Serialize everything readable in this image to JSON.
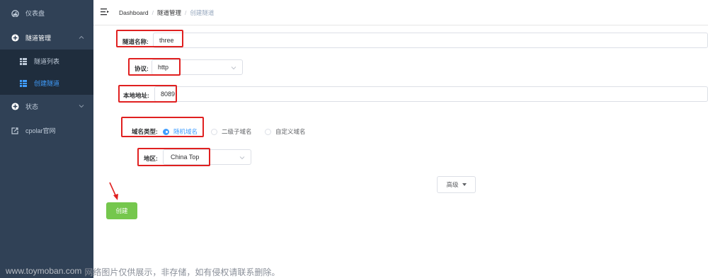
{
  "sidebar": {
    "items": [
      {
        "label": "仪表盘",
        "icon": "dashboard-icon"
      },
      {
        "label": "隧道管理",
        "icon": "plus-circle-icon",
        "expanded": true
      },
      {
        "label": "隧道列表",
        "icon": "grid-icon"
      },
      {
        "label": "创建隧道",
        "icon": "grid-icon",
        "active": true
      },
      {
        "label": "状态",
        "icon": "plus-circle-icon"
      },
      {
        "label": "cpolar官网",
        "icon": "external-link-icon"
      }
    ]
  },
  "breadcrumb": [
    "Dashboard",
    "隧道管理",
    "创建隧道"
  ],
  "breadcrumb_separator": "/",
  "form": {
    "tunnel_name": {
      "label": "隧道名称:",
      "value": "three"
    },
    "protocol": {
      "label": "协议:",
      "value": "http"
    },
    "local_address": {
      "label": "本地地址:",
      "value": "8089"
    },
    "domain_type": {
      "label": "域名类型:",
      "options": [
        "随机域名",
        "二级子域名",
        "自定义域名"
      ],
      "selected": "随机域名"
    },
    "region": {
      "label": "地区:",
      "value": "China Top"
    },
    "advanced_label": "高级",
    "create_label": "创建"
  },
  "watermark": {
    "url": "www.toymoban.com",
    "text": "网络图片仅供展示，非存储，如有侵权请联系删除。"
  },
  "colors": {
    "sidebar_bg": "#304156",
    "submenu_bg": "#1f2d3d",
    "active": "#409eff",
    "highlight": "#e02020",
    "create_button": "#67c23a"
  }
}
